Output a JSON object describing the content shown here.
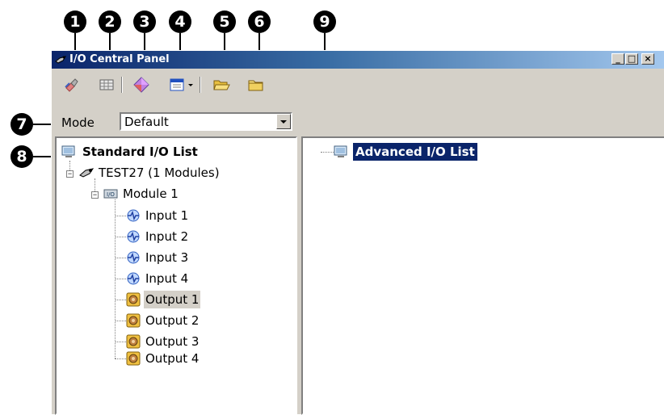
{
  "window": {
    "title": "I/O Central Panel",
    "controls": {
      "minimize": "_",
      "maximize": "□",
      "close": "×"
    }
  },
  "callouts": [
    "1",
    "2",
    "3",
    "4",
    "5",
    "6",
    "7",
    "8",
    "9"
  ],
  "toolbar": {
    "buttons": [
      {
        "icon": "wrench-icon"
      },
      {
        "icon": "grid-icon"
      },
      {
        "icon": "diamond-icon"
      },
      {
        "icon": "window-icon"
      },
      {
        "icon": "folder-open-icon"
      },
      {
        "icon": "folder-new-icon"
      }
    ]
  },
  "mode": {
    "label": "Mode",
    "value": "Default"
  },
  "standard_list": {
    "root": "Standard I/O List",
    "controller": "TEST27 (1 Modules)",
    "module": "Module 1",
    "inputs": [
      "Input 1",
      "Input 2",
      "Input 3",
      "Input 4"
    ],
    "outputs": [
      "Output 1",
      "Output 2",
      "Output 3",
      "Output 4"
    ],
    "selected": "Output 1"
  },
  "advanced_list": {
    "root": "Advanced I/O List"
  },
  "colors": {
    "titlebar": "#0a246a",
    "selection": "#0a246a",
    "face": "#d4d0c8"
  }
}
